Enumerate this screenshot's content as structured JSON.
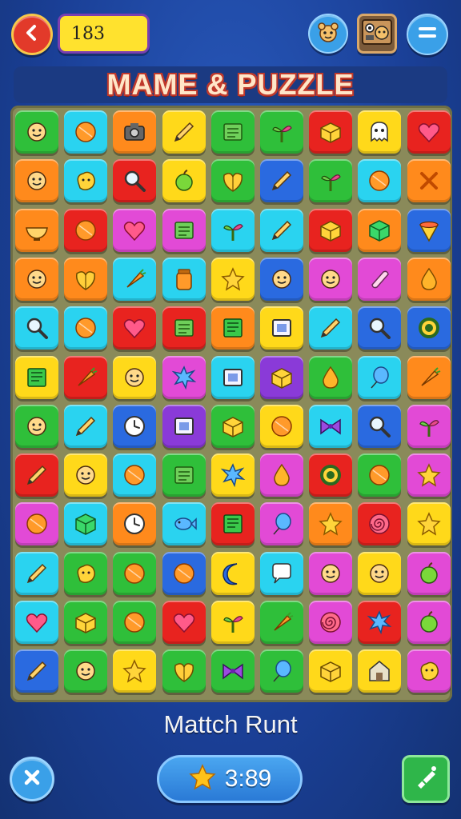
{
  "header": {
    "score": "183",
    "back_icon": "back-arrow-icon",
    "avatar_icon": "character-avatar-icon",
    "profile_icon": "profile-card-icon",
    "menu_icon": "menu-icon"
  },
  "title": "MAME & PUZZLE",
  "board": {
    "columns": 9,
    "rows": 12,
    "tiles": [
      [
        "green",
        "face"
      ],
      [
        "cyan",
        "ball"
      ],
      [
        "orange",
        "camera"
      ],
      [
        "yellow",
        "pencil"
      ],
      [
        "green",
        "note"
      ],
      [
        "green",
        "plant"
      ],
      [
        "red",
        "box"
      ],
      [
        "yellow",
        "ghost"
      ],
      [
        "red",
        "heart"
      ],
      [
        "orange",
        "face"
      ],
      [
        "cyan",
        "blob"
      ],
      [
        "red",
        "magnifier"
      ],
      [
        "yellow",
        "apple"
      ],
      [
        "green",
        "leaf"
      ],
      [
        "blue",
        "pencil"
      ],
      [
        "green",
        "plant"
      ],
      [
        "cyan",
        "ball"
      ],
      [
        "orange",
        "x"
      ],
      [
        "orange",
        "bowl"
      ],
      [
        "red",
        "ball"
      ],
      [
        "pink",
        "heart"
      ],
      [
        "pink",
        "note"
      ],
      [
        "cyan",
        "plant"
      ],
      [
        "cyan",
        "pencil"
      ],
      [
        "red",
        "box"
      ],
      [
        "orange",
        "cube"
      ],
      [
        "blue",
        "cone"
      ],
      [
        "orange",
        "face"
      ],
      [
        "orange",
        "leaf"
      ],
      [
        "cyan",
        "carrot"
      ],
      [
        "cyan",
        "jar"
      ],
      [
        "yellow",
        "star"
      ],
      [
        "blue",
        "face"
      ],
      [
        "pink",
        "face"
      ],
      [
        "pink",
        "scroll"
      ],
      [
        "orange",
        "drop"
      ],
      [
        "cyan",
        "magnifier"
      ],
      [
        "cyan",
        "ball"
      ],
      [
        "red",
        "heart"
      ],
      [
        "red",
        "note"
      ],
      [
        "orange",
        "book"
      ],
      [
        "yellow",
        "frame"
      ],
      [
        "cyan",
        "pencil"
      ],
      [
        "blue",
        "magnifier"
      ],
      [
        "blue",
        "ring"
      ],
      [
        "yellow",
        "book"
      ],
      [
        "red",
        "carrot"
      ],
      [
        "yellow",
        "face"
      ],
      [
        "pink",
        "splash"
      ],
      [
        "cyan",
        "frame"
      ],
      [
        "purple",
        "box"
      ],
      [
        "green",
        "drop"
      ],
      [
        "cyan",
        "balloon"
      ],
      [
        "orange",
        "carrot"
      ],
      [
        "green",
        "face"
      ],
      [
        "cyan",
        "pencil"
      ],
      [
        "blue",
        "clock"
      ],
      [
        "purple",
        "frame"
      ],
      [
        "green",
        "box"
      ],
      [
        "yellow",
        "ball"
      ],
      [
        "cyan",
        "ribbon"
      ],
      [
        "blue",
        "magnifier"
      ],
      [
        "pink",
        "plant"
      ],
      [
        "red",
        "pencil"
      ],
      [
        "yellow",
        "face"
      ],
      [
        "cyan",
        "ball"
      ],
      [
        "green",
        "note"
      ],
      [
        "yellow",
        "splash"
      ],
      [
        "pink",
        "drop"
      ],
      [
        "red",
        "ring"
      ],
      [
        "green",
        "ball"
      ],
      [
        "pink",
        "star"
      ],
      [
        "pink",
        "ball"
      ],
      [
        "cyan",
        "cube"
      ],
      [
        "orange",
        "clock"
      ],
      [
        "cyan",
        "fish"
      ],
      [
        "red",
        "book"
      ],
      [
        "pink",
        "balloon"
      ],
      [
        "orange",
        "star"
      ],
      [
        "red",
        "swirl"
      ],
      [
        "yellow",
        "star"
      ],
      [
        "cyan",
        "pencil"
      ],
      [
        "green",
        "blob"
      ],
      [
        "green",
        "ball"
      ],
      [
        "blue",
        "ball"
      ],
      [
        "yellow",
        "moon"
      ],
      [
        "cyan",
        "bubble"
      ],
      [
        "pink",
        "face"
      ],
      [
        "yellow",
        "face"
      ],
      [
        "pink",
        "apple"
      ],
      [
        "cyan",
        "heart"
      ],
      [
        "green",
        "box"
      ],
      [
        "green",
        "ball"
      ],
      [
        "red",
        "heart"
      ],
      [
        "yellow",
        "plant"
      ],
      [
        "green",
        "carrot"
      ],
      [
        "pink",
        "swirl"
      ],
      [
        "red",
        "splash"
      ],
      [
        "pink",
        "apple"
      ],
      [
        "blue",
        "pencil"
      ],
      [
        "green",
        "face"
      ],
      [
        "yellow",
        "star"
      ],
      [
        "green",
        "leaf"
      ],
      [
        "green",
        "ribbon"
      ],
      [
        "green",
        "balloon"
      ],
      [
        "yellow",
        "box"
      ],
      [
        "yellow",
        "house"
      ],
      [
        "pink",
        "blob"
      ]
    ]
  },
  "footer": {
    "label": "Mattch Runt",
    "timer": "3:89",
    "close_icon": "close-icon",
    "timer_icon": "star-icon",
    "hint_icon": "hint-bottle-icon"
  },
  "palette": {
    "green": "#2fbf3a",
    "cyan": "#2ad3f0",
    "orange": "#ff8a1c",
    "yellow": "#ffd91a",
    "red": "#e8231f",
    "pink": "#e24ad6",
    "blue": "#2a6ae0",
    "purple": "#8a3ad8"
  }
}
